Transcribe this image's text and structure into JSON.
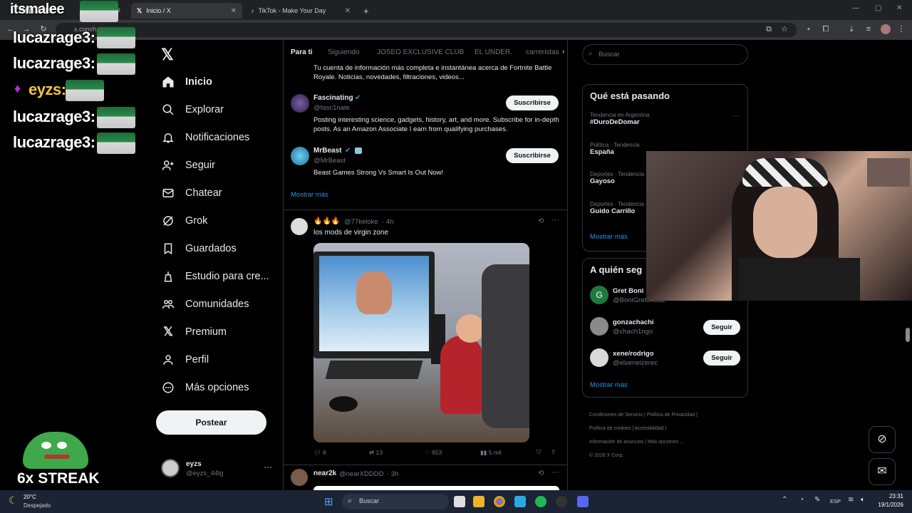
{
  "browser": {
    "tabs": [
      {
        "label": "itsmalee"
      },
      {
        "label": "Inicio / X"
      },
      {
        "label": "TikTok - Make Your Day"
      }
    ],
    "new_tab_label": "+",
    "url": "x.com/h"
  },
  "x_nav": {
    "items": [
      {
        "label": "Inicio",
        "icon": "home-icon"
      },
      {
        "label": "Explorar",
        "icon": "search-icon"
      },
      {
        "label": "Notificaciones",
        "icon": "bell-icon"
      },
      {
        "label": "Seguir",
        "icon": "person-add-icon"
      },
      {
        "label": "Chatear",
        "icon": "mail-icon"
      },
      {
        "label": "Grok",
        "icon": "grok-icon"
      },
      {
        "label": "Guardados",
        "icon": "bookmark-icon"
      },
      {
        "label": "Estudio para cre...",
        "icon": "studio-icon"
      },
      {
        "label": "Comunidades",
        "icon": "communities-icon"
      },
      {
        "label": "Premium",
        "icon": "x-logo-icon"
      },
      {
        "label": "Perfil",
        "icon": "person-icon"
      },
      {
        "label": "Más opciones",
        "icon": "more-circle-icon"
      }
    ],
    "post_button": "Postear",
    "account": {
      "name": "eyzs",
      "handle": "@eyzs_44lg"
    }
  },
  "timeline": {
    "tabs": [
      "Para ti",
      "Siguiendo",
      "JOSEO EXCLUSIVE CLUB",
      "EL UNDER.",
      "carreristas"
    ],
    "truncated_bio": "Tu cuenta de información más completa e instantánea acerca de Fortnite Battle Royale. Noticias, novedades, filtraciones, videos...",
    "suggestions": [
      {
        "name": "Fascinating",
        "handle": "@fasc1nate",
        "bio": "Posting interesting science, gadgets, history, art, and more. Subscribe for in-depth posts. As an Amazon Associate I earn from qualifying purchases.",
        "button": "Suscribirse"
      },
      {
        "name": "MrBeast",
        "handle": "@MrBeast",
        "bio": "Beast Games Strong Vs Smart Is Out Now!",
        "button": "Suscribirse"
      }
    ],
    "show_more": "Mostrar más",
    "post": {
      "name": "🔥🔥🔥",
      "handle": "@77keloke",
      "time": "· 4h",
      "text": "los mods de virgin zone",
      "replies": "6",
      "reposts": "13",
      "likes": "653",
      "views": "5 mil"
    },
    "next_post": {
      "name": "near2k",
      "handle": "@nearXDDDD",
      "time": "· 3h"
    }
  },
  "sidebar": {
    "search_placeholder": "Buscar",
    "trends_title": "Qué está pasando",
    "trends": [
      {
        "category": "Tendencia en Argentina",
        "name": "#DuroDeDomar"
      },
      {
        "category": "Política · Tendencia",
        "name": "España"
      },
      {
        "category": "Deportes · Tendencia",
        "name": "Gayoso"
      },
      {
        "category": "Deportes · Tendencia",
        "name": "Guido Carrillo"
      }
    ],
    "trends_more": "Mostrar más",
    "who_title": "A quién seg",
    "who": [
      {
        "name": "Gret Boni",
        "handle": "@BoniGret54562",
        "button": "Seguir"
      },
      {
        "name": "gonzachachi",
        "handle": "@chach1ngo",
        "button": "Seguir"
      },
      {
        "name": "xene/rodrigo",
        "handle": "@elxeneizerec",
        "button": "Seguir"
      }
    ],
    "who_more": "Mostrar más",
    "footer": [
      "Condiciones de Servicio",
      "Política de Privacidad",
      "Política de cookies",
      "Accesibilidad",
      "Información de anuncios",
      "Más opciones ...",
      "© 2026 X Corp."
    ]
  },
  "stream_overlay": {
    "chat": [
      {
        "user": "lucazrage3:"
      },
      {
        "user": "lucazrage3:"
      },
      {
        "user": "eyzs:"
      },
      {
        "user": "lucazrage3:"
      },
      {
        "user": "lucazrage3:"
      }
    ],
    "streak": "6x STREAK"
  },
  "taskbar": {
    "weather_temp": "20°C",
    "weather_desc": "Despejado",
    "search": "Buscar",
    "lang": "ESP",
    "time": "23:31",
    "date": "19/1/2026"
  },
  "colors": {
    "accent": "#1d9bf0",
    "verified": "#1d9bf0"
  }
}
